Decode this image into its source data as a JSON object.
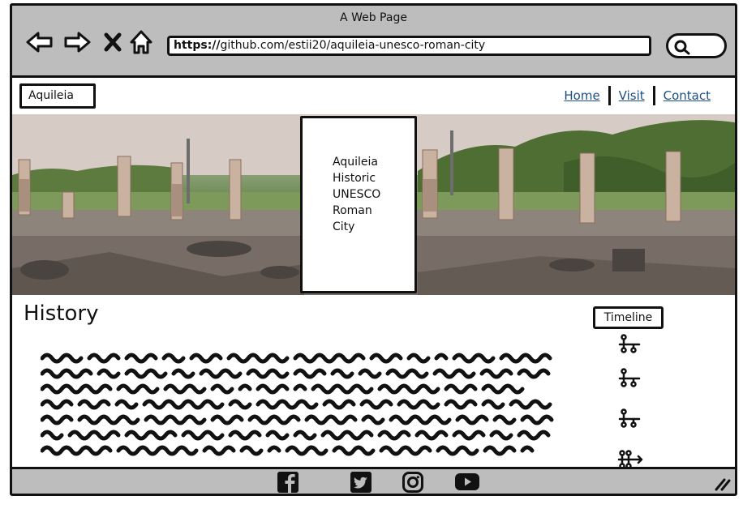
{
  "browser": {
    "window_title": "A Web Page",
    "url_scheme": "https://",
    "url_rest": "github.com/estii20/aquileia-unesco-roman-city",
    "icons": [
      "back-arrow-icon",
      "forward-arrow-icon",
      "close-icon",
      "home-icon",
      "search-icon"
    ]
  },
  "nav": {
    "logo": "Aquileia",
    "links": [
      {
        "label": "Home"
      },
      {
        "label": "Visit"
      },
      {
        "label": "Contact"
      }
    ]
  },
  "hero": {
    "image": "roman-forum-ruins-photo",
    "card_lines": [
      "Aquileia",
      "Historic",
      "UNESCO",
      "Roman",
      "City"
    ]
  },
  "main": {
    "section_title": "History",
    "timeline_button": "Timeline",
    "timeline_icons": [
      "sitemap-icon",
      "sitemap-icon",
      "sitemap-icon",
      "sitemap-arrow-icon"
    ]
  },
  "footer": {
    "social_icons": [
      "facebook-icon",
      "twitter-icon",
      "instagram-icon",
      "youtube-icon"
    ]
  },
  "colors": {
    "chrome": "#bdbdbd",
    "link": "#1b4f86",
    "ink": "#111111"
  }
}
